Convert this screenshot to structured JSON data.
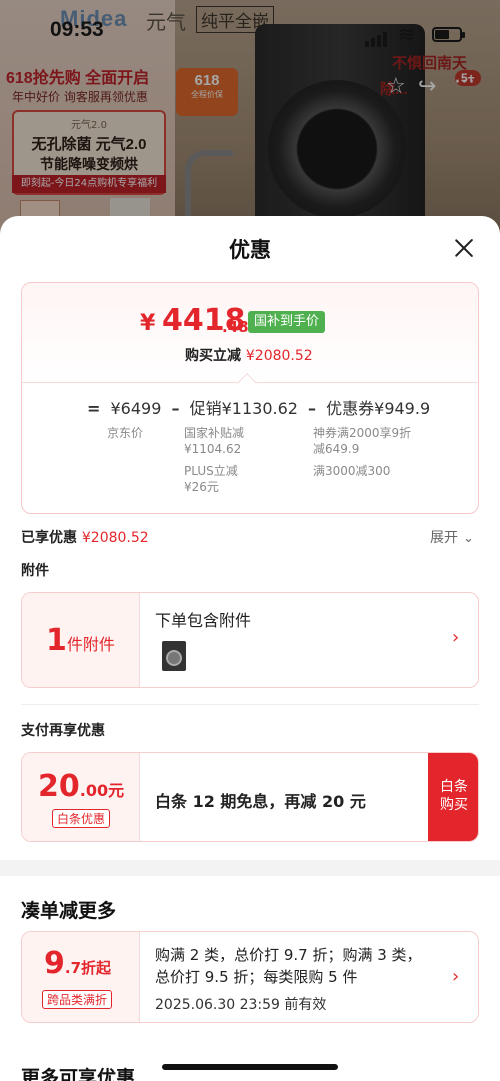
{
  "banner": {
    "brand": "Midea",
    "series": "元气",
    "series2": "纯平全嵌",
    "sale_text": "618抢先购 全面开启",
    "sub_text": "年中好价 询客服再领优惠",
    "box_version": "元气2.0",
    "box_line1": "无孔除菌 元气2.0",
    "box_line2": "节能降噪变频烘",
    "box_strip": "即刻起-今日24点购机专享福利",
    "badge_618": "618",
    "badge_618_sub": "全程价保",
    "right_text1": "不惧回南天",
    "right_badge": "5+",
    "right_text3": "除..."
  },
  "status": {
    "time": "09:53"
  },
  "sheet": {
    "title": "优惠",
    "price": {
      "symbol": "¥",
      "integer": "4418",
      "decimal": ".48",
      "tag": "国补到手价",
      "cut_label": "购买立减",
      "cut_value": "¥2080.52"
    },
    "formula": {
      "eq": "=",
      "jd_price": "¥6499",
      "jd_label": "京东价",
      "minus1": "–",
      "promo": "促销¥1130.62",
      "promo_detail1": "国家补贴减",
      "promo_detail1_val": "¥1104.62",
      "promo_detail2": "PLUS立减",
      "promo_detail2_val": "¥26元",
      "minus2": "–",
      "coupon": "优惠券¥949.9",
      "coupon_detail1": "神券满2000享9折",
      "coupon_detail1b": "减649.9",
      "coupon_detail2": "满3000减300"
    },
    "enjoyed": {
      "label": "已享优惠",
      "value": "¥2080.52",
      "expand": "展开"
    },
    "accessory": {
      "section": "附件",
      "count": "1",
      "count_unit": "件附件",
      "title": "下单包含附件"
    },
    "payment": {
      "section": "支付再享优惠",
      "amount_int": "20",
      "amount_dec": ".00元",
      "tag": "白条优惠",
      "desc": "白条 12 期免息，再减 20 元",
      "buy_button": "白条购买"
    },
    "bundle": {
      "section": "凑单减更多",
      "discount_int": "9",
      "discount_dec": ".7折起",
      "tag": "跨品类满折",
      "desc": "购满 2 类，总价打 9.7 折；购满 3 类，总价打 9.5 折；每类限购 5 件",
      "expiry": "2025.06.30 23:59 前有效"
    },
    "more_section": "更多可享优惠"
  },
  "colors": {
    "accent": "#e3262c",
    "green_tag": "#4fb04f",
    "pink_bg": "#fff3f2"
  }
}
